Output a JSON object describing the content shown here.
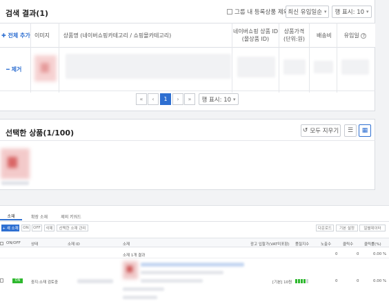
{
  "search": {
    "title": "검색 결과(1)",
    "group_checkbox_label": "그룹 내 등록상품 제외",
    "sort_select": "최신 유입일순",
    "rows_select": "행 표시: 10",
    "add_all": "전체 추가",
    "columns": {
      "image": "이미지",
      "product_name": "상품명 (네이버쇼핑카테고리 / 쇼핑몰카테고리)",
      "product_id": "네이버쇼핑 상품 ID\n(몰상품 ID)",
      "price": "상품가격\n(단위:원)",
      "shipping": "배송비",
      "inflow_date": "유입일"
    },
    "row_action": "제거",
    "pagination": {
      "first": "«",
      "prev": "‹",
      "current": "1",
      "next": "›",
      "last": "»",
      "rows_select": "행 표시: 10"
    }
  },
  "selected": {
    "title": "선택한 상품(1/100)",
    "clear_all": "모두 지우기"
  },
  "bottom": {
    "tabs": [
      "소재",
      "확장 소재",
      "제외 키워드"
    ],
    "toolbar": {
      "new_button": "+ 새 소재",
      "on": "ON",
      "off": "OFF",
      "delete": "삭제",
      "more": "선택한 소재 관리",
      "download": "다운로드",
      "filter": "기본 설정",
      "columns": "일별데이터"
    },
    "headers": {
      "onoff": "ON/OFF",
      "status": "상태",
      "creative_id": "소재 ID",
      "creative": "소재",
      "bid": "광고 입찰가(VAT미포함)",
      "quality": "품질지수",
      "impressions": "노출수",
      "clicks": "클릭수",
      "ctr": "클릭률(%)"
    },
    "summary": {
      "label": "소재 1개 결과",
      "impressions": "0",
      "clicks": "0",
      "ctr": "0.00 %"
    },
    "row": {
      "toggle": "ON",
      "status": "중지:소재 검토중",
      "bid_text": "[기본] 10원",
      "impressions": "0",
      "clicks": "0",
      "ctr": "0.00 %"
    }
  }
}
